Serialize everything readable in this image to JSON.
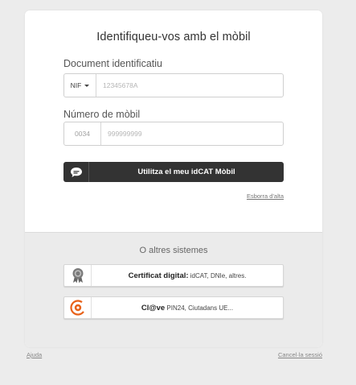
{
  "card": {
    "title": "Identifiqueu-vos amb el mòbil"
  },
  "document": {
    "label": "Document identificatiu",
    "type_selected": "NIF",
    "placeholder": "12345678A"
  },
  "mobile": {
    "label": "Número de mòbil",
    "prefix": "0034",
    "placeholder": "999999999"
  },
  "idcat_button": {
    "label": "Utilitza el meu idCAT Mòbil",
    "icon": "chat-bubble-icon"
  },
  "register_link": "Esborra d'alta",
  "alternatives": {
    "title": "O altres sistemes",
    "certificate": {
      "title": "Certificat digital:",
      "detail": "idCAT, DNIe, altres.",
      "icon": "certificate-badge-icon"
    },
    "clave": {
      "title": "Cl@ve",
      "detail": "PIN24, Ciutadans UE...",
      "icon": "clave-logo-icon"
    }
  },
  "footer": {
    "help": "Ajuda",
    "cancel": "Cancel·la sessió"
  },
  "colors": {
    "dark_button": "#333333",
    "clave_orange": "#e8621a",
    "background": "#ebebeb"
  }
}
